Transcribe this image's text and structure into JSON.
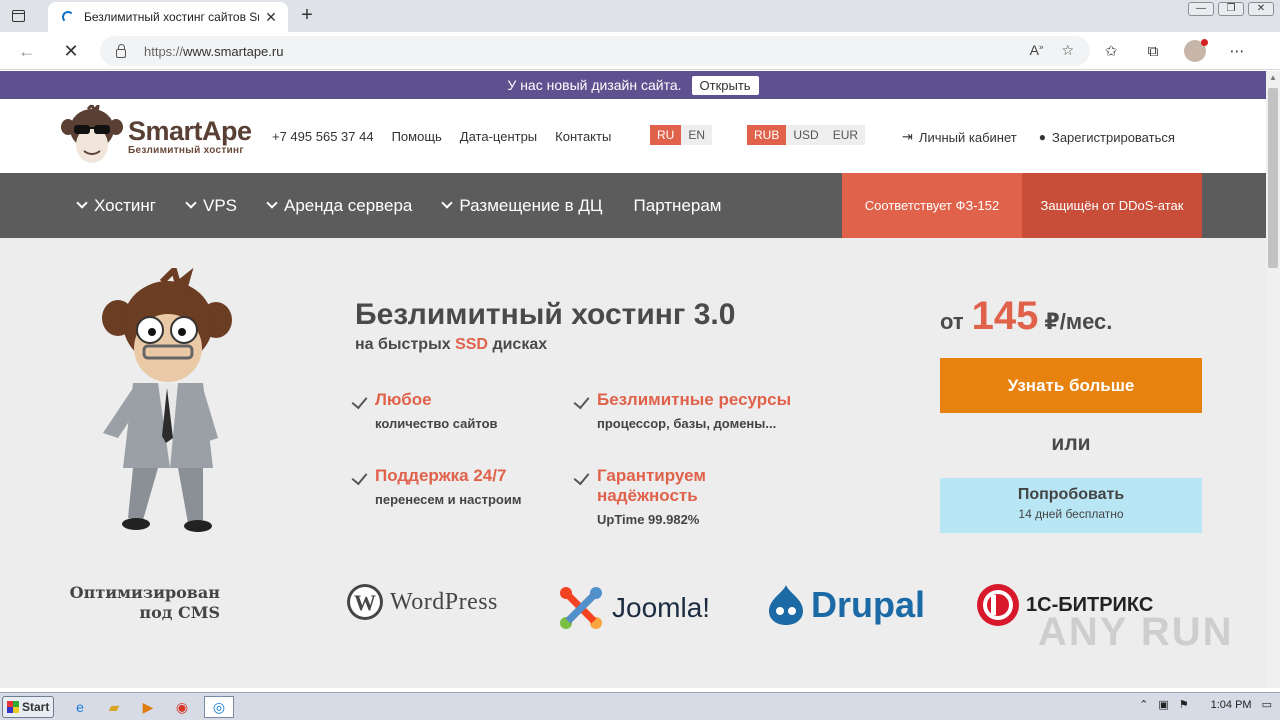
{
  "browser": {
    "tab_title": "Безлимитный хостинг сайтов Sr",
    "tab_close": "✕",
    "new_tab": "+",
    "url_proto": "https://",
    "url_host": "www.smartape.ru",
    "win_min": "—",
    "win_max": "❐",
    "win_close": "✕"
  },
  "notice": {
    "text": "У нас новый дизайн сайта.",
    "button": "Открыть"
  },
  "header": {
    "logo_name": "SmartApe",
    "logo_sub": "Безлимитный хостинг",
    "phone": "+7 495 565 37 44",
    "links": [
      "Помощь",
      "Дата-центры",
      "Контакты"
    ],
    "langs": [
      "RU",
      "EN"
    ],
    "currencies": [
      "RUB",
      "USD",
      "EUR"
    ],
    "login": "Личный кабинет",
    "register": "Зарегистрироваться"
  },
  "menu": {
    "items": [
      "Хостинг",
      "VPS",
      "Аренда сервера",
      "Размещение в ДЦ"
    ],
    "partners": "Партнерам",
    "badge_fz": "Соответствует ФЗ-152",
    "badge_ddos": "Защищён от DDoS-атак"
  },
  "hero": {
    "title": "Безлимитный хостинг 3.0",
    "subtitle_pre": "на быстрых",
    "subtitle_hl": "SSD",
    "subtitle_post": "дисках",
    "features": [
      {
        "title": "Любое",
        "sub": "количество сайтов"
      },
      {
        "title": "Безлимитные ресурсы",
        "sub": "процессор, базы, домены..."
      },
      {
        "title": "Поддержка 24/7",
        "sub": "перенесем и настроим"
      },
      {
        "title": "Гарантируем надёжность",
        "sub": "UpTime 99.982%"
      }
    ],
    "price_pre": "от",
    "price_amount": "145",
    "price_post": "₽/мес.",
    "btn_more": "Узнать больше",
    "or": "или",
    "try_title": "Попробовать",
    "try_sub": "14 дней бесплатно"
  },
  "cms": {
    "label_line1": "Оптимизирован",
    "label_line2": "под CMS",
    "wordpress": "WordPress",
    "joomla": "Joomla!",
    "drupal": "Drupal",
    "bitrix": "1С-БИТРИКС"
  },
  "watermark": "ANY RUN",
  "taskbar": {
    "start": "Start",
    "time": "1:04 PM"
  },
  "colors": {
    "accent": "#e0624b",
    "notice_bg": "#5f5090",
    "menu_bg": "#5c5c5c",
    "orange_btn": "#e8820e",
    "try_btn": "#b9e6f5"
  }
}
